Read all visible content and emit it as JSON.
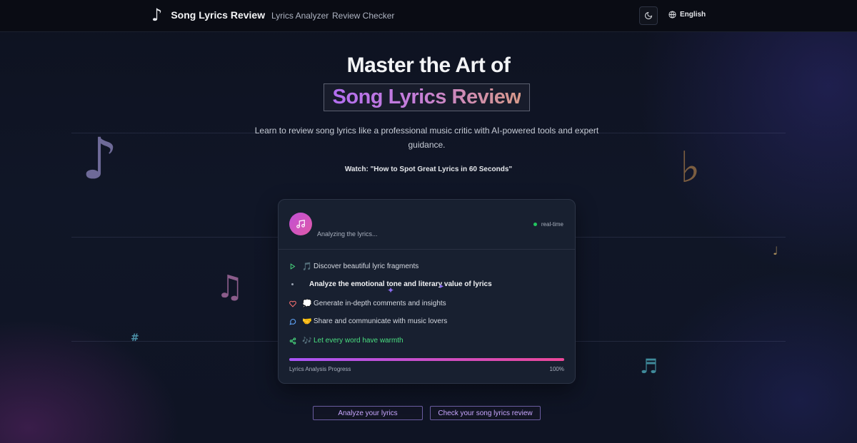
{
  "nav": {
    "brand_icon": "music-note-icon",
    "brand_title": "Song Lyrics Review",
    "links": [
      "Lyrics Analyzer",
      "Review Checker"
    ],
    "theme_icon": "moon-icon",
    "language_icon": "globe-icon",
    "language": "English"
  },
  "hero": {
    "title_line1": "Master the Art of",
    "title_highlight": "Song Lyrics Review",
    "description": "Learn to review song lyrics like a professional music critic with AI-powered tools and expert guidance.",
    "watch": "Watch: \"How to Spot Great Lyrics in 60 Seconds\""
  },
  "card": {
    "avatar_icon": "music-icon",
    "status": "Analyzing the lyrics...",
    "realtime": "real-time",
    "features": [
      {
        "icon": "play-icon",
        "emoji": "🎵",
        "text": "Discover beautiful lyric fragments"
      },
      {
        "icon": "bullet",
        "emoji": "",
        "text": "Analyze the emotional tone and literary value of lyrics"
      },
      {
        "icon": "heart-icon",
        "emoji": "💭",
        "text": "Generate in-depth comments and insights"
      },
      {
        "icon": "message-icon",
        "emoji": "🤝",
        "text": "Share and communicate with music lovers"
      },
      {
        "icon": "share-icon",
        "emoji": "🎶",
        "text": "Let every word have warmth"
      }
    ],
    "progress_label": "Lyrics Analysis Progress",
    "progress_value": 100,
    "progress_text": "100%"
  },
  "buttons": {
    "analyze": "Analyze your lyrics",
    "check": "Check your song lyrics review"
  },
  "decor": {
    "note1": "♪",
    "flat": "♭",
    "note2": "♫",
    "note3": "♩",
    "sharp": "#",
    "note4": "♬"
  },
  "colors": {
    "accent_purple": "#a855f7",
    "accent_pink": "#ec4899",
    "green": "#22c55e"
  }
}
